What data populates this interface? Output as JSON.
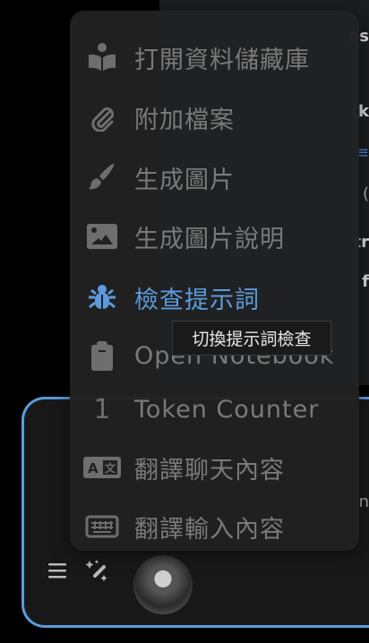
{
  "background_fragments": [
    "es",
    "(k",
    "",
    "(",
    "tr",
    "f",
    "n"
  ],
  "menu": {
    "items": [
      {
        "label": "打開資料儲藏庫",
        "icon": "book-reader-icon"
      },
      {
        "label": "附加檔案",
        "icon": "paperclip-icon"
      },
      {
        "label": "生成圖片",
        "icon": "paintbrush-icon"
      },
      {
        "label": "生成圖片說明",
        "icon": "image-icon"
      },
      {
        "label": "檢查提示詞",
        "icon": "bug-icon",
        "active": true
      },
      {
        "label": "Open Notebook",
        "icon": "clipboard-icon"
      },
      {
        "label": "Token Counter",
        "icon": "number-one-icon",
        "icon_text": "1"
      },
      {
        "label": "翻譯聊天內容",
        "icon": "translate-icon"
      },
      {
        "label": "翻譯輸入內容",
        "icon": "keyboard-icon"
      }
    ]
  },
  "tooltip": "切換提示詞檢查",
  "colors": {
    "accent": "#5b9bdc",
    "menu_bg": "#212122",
    "item_text": "#7a7a7a"
  }
}
